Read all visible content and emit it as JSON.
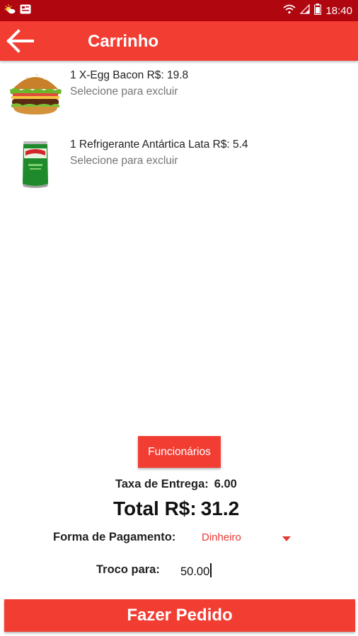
{
  "status_bar": {
    "time": "18:40",
    "icons": [
      "weather-icon",
      "notification-icon",
      "wifi-icon",
      "signal-icon",
      "battery-icon"
    ]
  },
  "app_bar": {
    "title": "Carrinho",
    "back_icon": "arrow-back-icon"
  },
  "cart": {
    "items": [
      {
        "name": "1 X-Egg Bacon R$: 19.8",
        "hint": "Selecione para excluir",
        "image": "burger"
      },
      {
        "name": "1 Refrigerante Antártica Lata R$: 5.4",
        "hint": "Selecione para excluir",
        "image": "soda-can"
      }
    ]
  },
  "actions": {
    "employees_label": "Funcionários",
    "order_label": "Fazer Pedido"
  },
  "summary": {
    "delivery_fee_label": "Taxa de Entrega:",
    "delivery_fee_value": "6.00",
    "total_label": "Total R$:",
    "total_value": "31.2",
    "payment_label": "Forma de Pagamento:",
    "payment_value": "Dinheiro",
    "change_label": "Troco para:",
    "change_value": "50.00"
  },
  "colors": {
    "primary": "#f23d33",
    "status_bar": "#b0060f",
    "accent_text": "#e53935"
  }
}
